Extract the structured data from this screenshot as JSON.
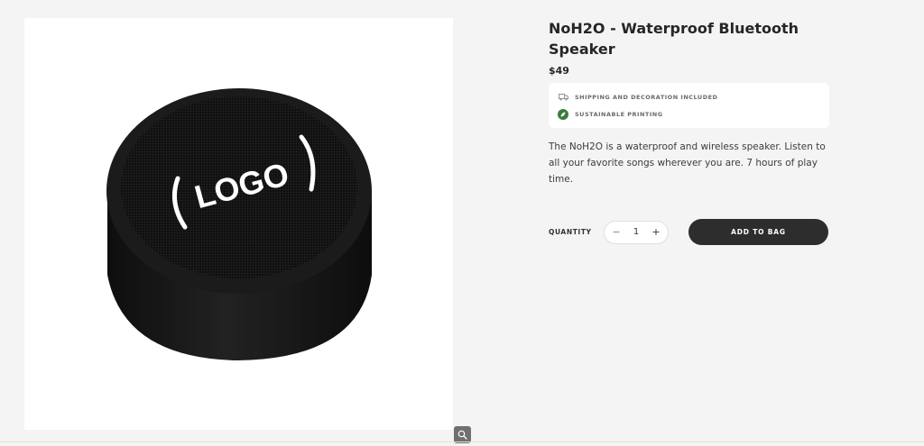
{
  "product": {
    "title": "NoH2O - Waterproof Bluetooth Speaker",
    "price": "$49",
    "image_logo_text": "LOGO",
    "description": "The NoH2O is a waterproof and wireless speaker.  Listen to all your favorite songs wherever you are. 7 hours of play time."
  },
  "features": [
    {
      "icon": "truck-icon",
      "label": "SHIPPING AND DECORATION INCLUDED"
    },
    {
      "icon": "leaf-icon",
      "label": "SUSTAINABLE PRINTING",
      "color": "#3a7d3a"
    }
  ],
  "purchase": {
    "quantity_label": "QUANTITY",
    "decrement": "−",
    "quantity": "1",
    "increment": "+",
    "add_to_bag": "ADD TO BAG"
  },
  "colors": {
    "page_bg": "#f4f4f4",
    "button_bg": "#2d2d2d",
    "speaker": "#1a1a1a"
  }
}
